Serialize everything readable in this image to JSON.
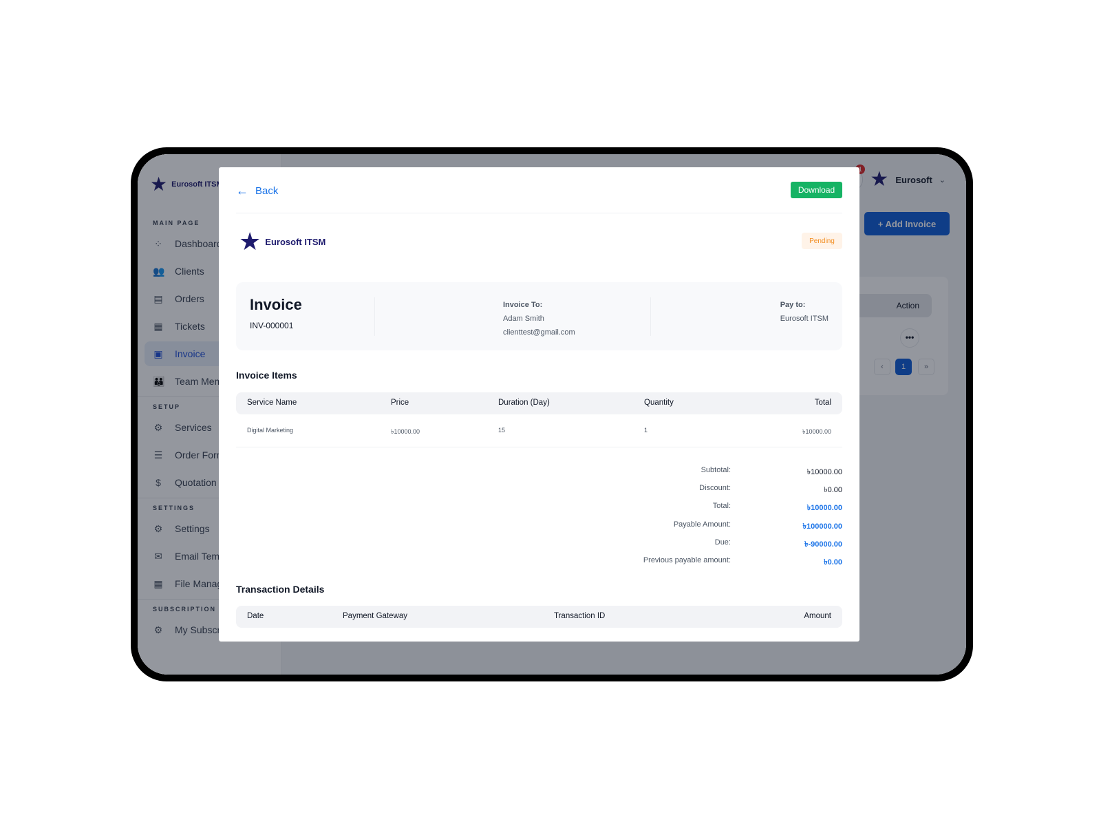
{
  "app": {
    "brand": "Eurosoft ITSM",
    "sidebar": {
      "sections": [
        {
          "label": "MAIN PAGE",
          "items": [
            {
              "label": "Dashboard",
              "icon": "grid-icon"
            },
            {
              "label": "Clients",
              "icon": "users-icon"
            },
            {
              "label": "Orders",
              "icon": "document-icon"
            },
            {
              "label": "Tickets",
              "icon": "ticket-icon"
            },
            {
              "label": "Invoice",
              "icon": "clipboard-icon",
              "active": true
            },
            {
              "label": "Team Members",
              "icon": "team-icon"
            }
          ]
        },
        {
          "label": "SETUP",
          "items": [
            {
              "label": "Services",
              "icon": "gear-icon"
            },
            {
              "label": "Order Forms",
              "icon": "form-icon"
            },
            {
              "label": "Quotation",
              "icon": "quotation-icon"
            }
          ]
        },
        {
          "label": "SETTINGS",
          "items": [
            {
              "label": "Settings",
              "icon": "gear-icon"
            },
            {
              "label": "Email Templates",
              "icon": "mail-icon"
            },
            {
              "label": "File Manager",
              "icon": "folder-icon"
            }
          ]
        },
        {
          "label": "SUBSCRIPTION",
          "items": [
            {
              "label": "My Subscription",
              "icon": "gear-icon"
            }
          ]
        }
      ]
    },
    "topbar": {
      "notification_count": "1",
      "user_name": "Eurosoft",
      "chevron": "⌄"
    },
    "add_invoice_label": "+ Add Invoice",
    "table_action_header": "Action",
    "row_menu": "•••",
    "pagination": {
      "prev": "‹",
      "current": "1",
      "next": "»"
    }
  },
  "modal": {
    "back_label": "Back",
    "back_arrow": "←",
    "download_label": "Download",
    "brand_name": "Eurosoft ITSM",
    "status": "Pending",
    "invoice": {
      "title": "Invoice",
      "number": "INV-000001",
      "invoice_to_label": "Invoice To:",
      "client_name": "Adam Smith",
      "client_email": "clienttest@gmail.com",
      "pay_to_label": "Pay to:",
      "pay_to_name": "Eurosoft ITSM"
    },
    "items": {
      "title": "Invoice Items",
      "headers": [
        "Service Name",
        "Price",
        "Duration (Day)",
        "Quantity",
        "Total"
      ],
      "rows": [
        [
          "Digital Marketing",
          "৳10000.00",
          "15",
          "1",
          "৳10000.00"
        ]
      ]
    },
    "summary": [
      {
        "label": "Subtotal:",
        "value": "৳10000.00",
        "highlight": false
      },
      {
        "label": "Discount:",
        "value": "৳0.00",
        "highlight": false
      },
      {
        "label": "Total:",
        "value": "৳10000.00",
        "highlight": true
      },
      {
        "label": "Payable Amount:",
        "value": "৳100000.00",
        "highlight": true
      },
      {
        "label": "Due:",
        "value": "৳-90000.00",
        "highlight": true
      },
      {
        "label": "Previous payable amount:",
        "value": "৳0.00",
        "highlight": true
      }
    ],
    "transactions": {
      "title": "Transaction Details",
      "headers": [
        "Date",
        "Payment Gateway",
        "Transaction ID",
        "Amount"
      ]
    }
  }
}
